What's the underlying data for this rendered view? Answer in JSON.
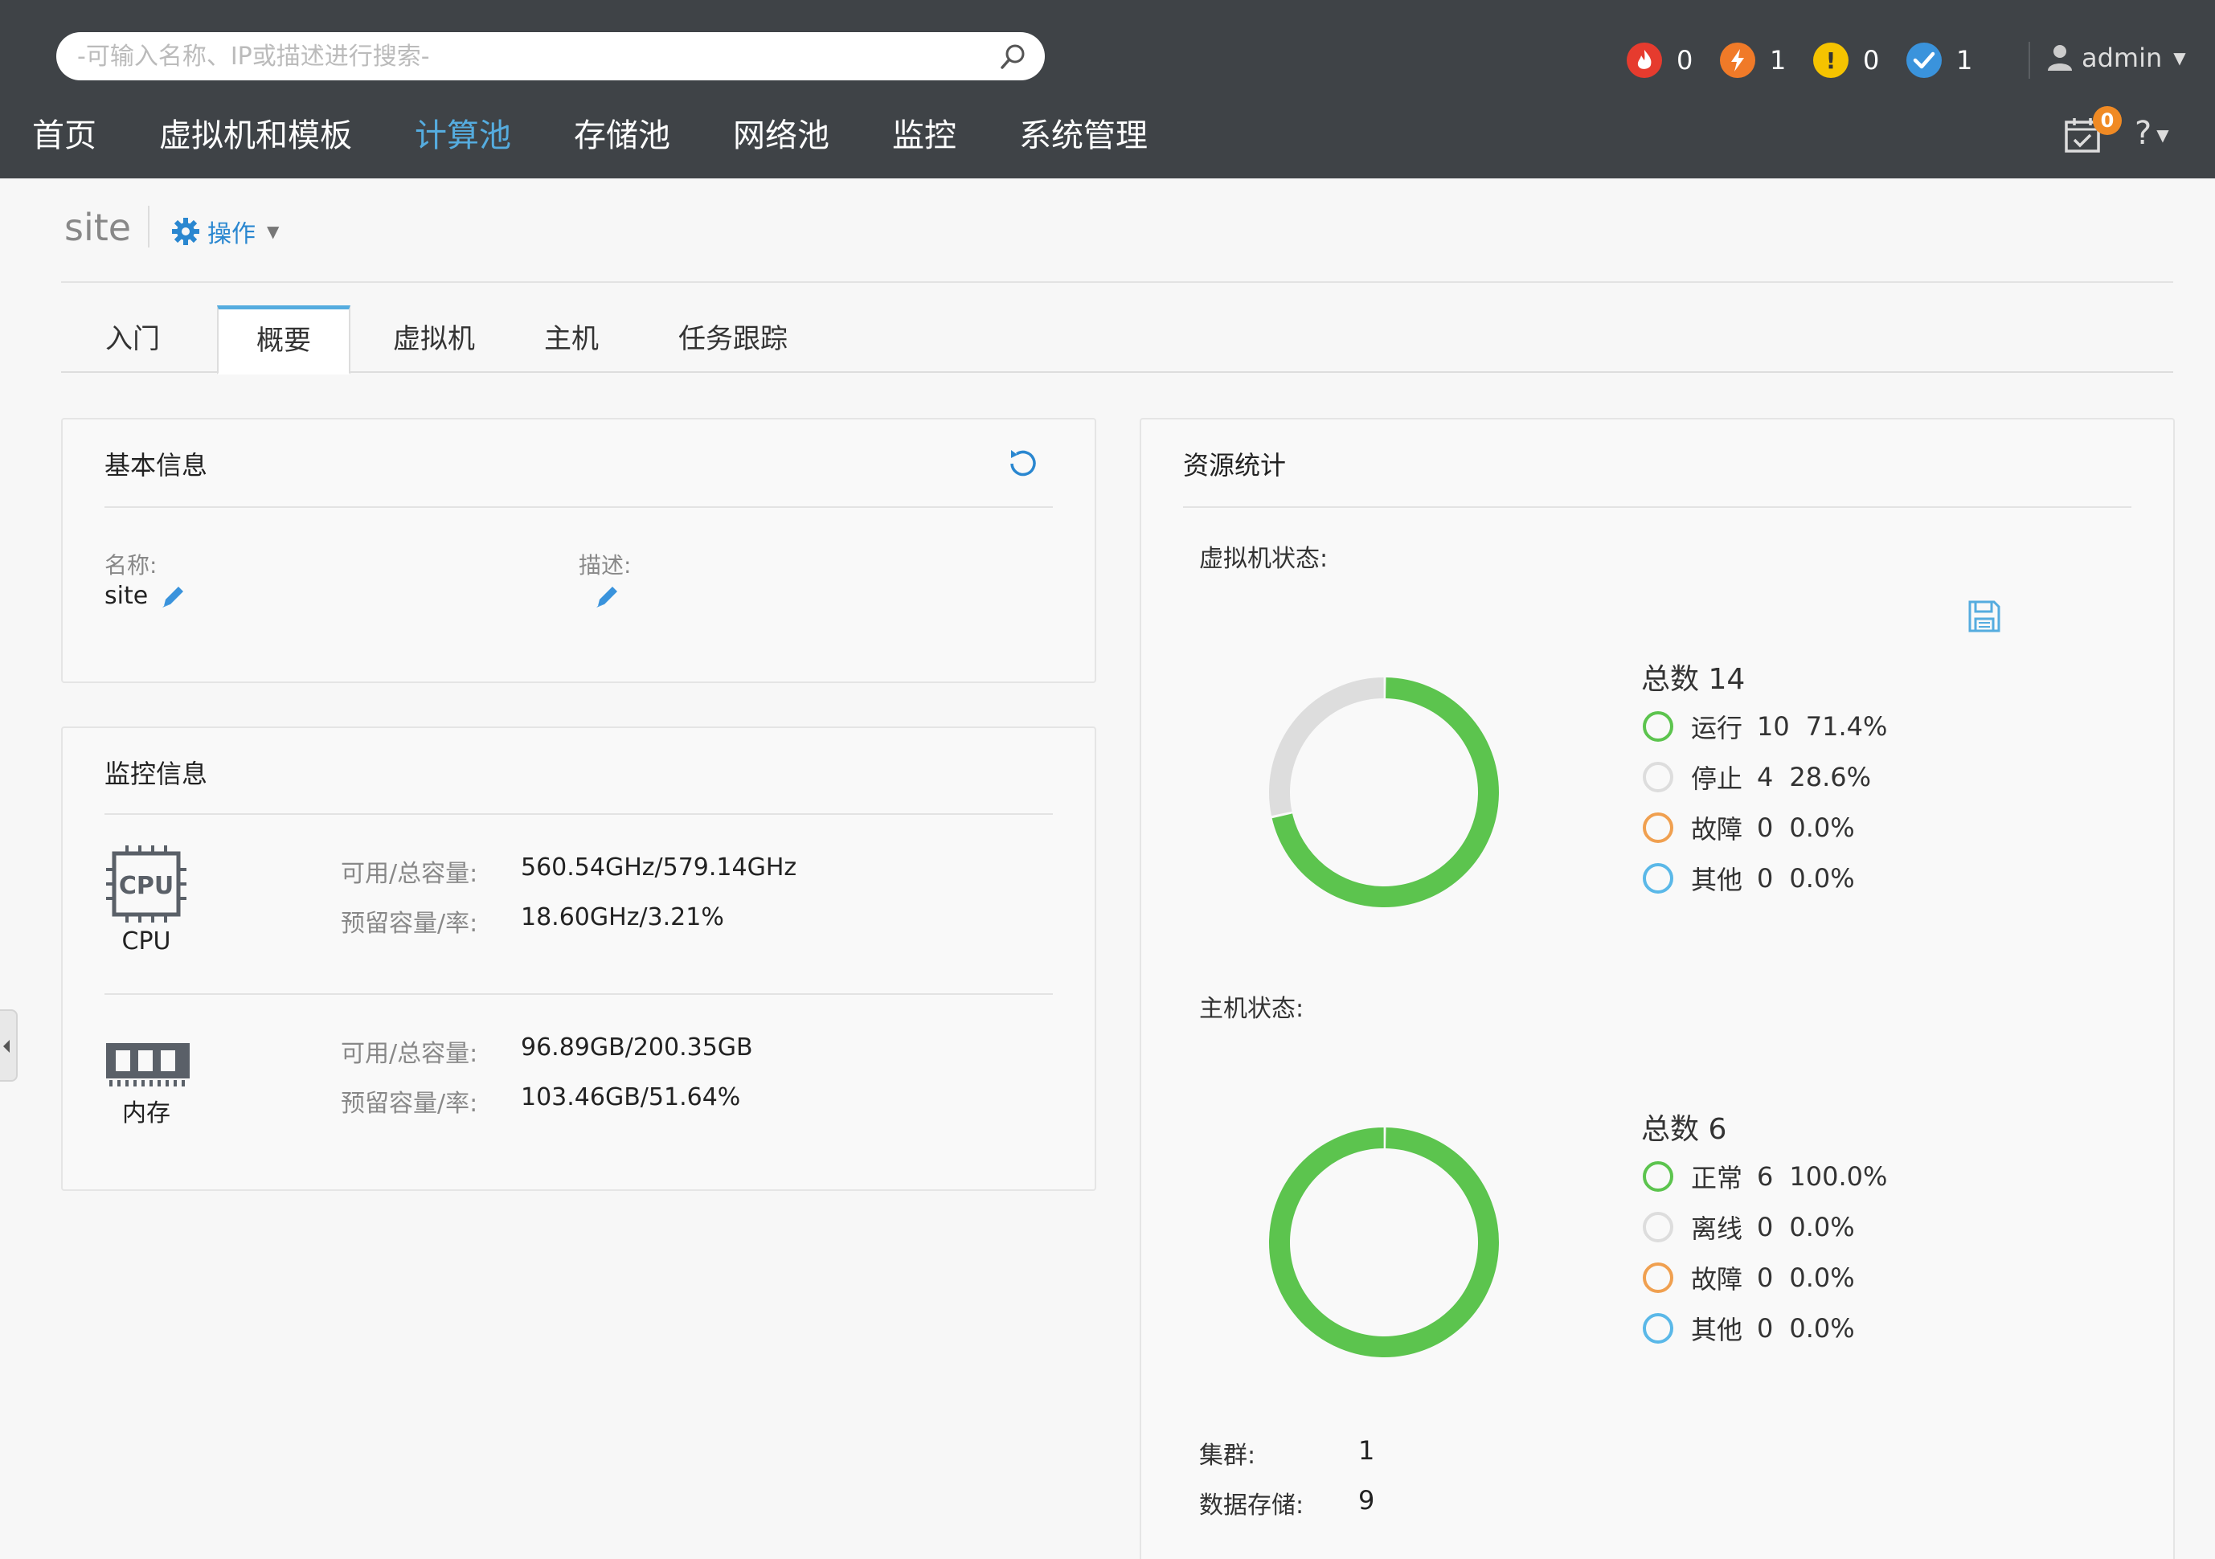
{
  "header": {
    "search": {
      "placeholder": "-可输入名称、IP或描述进行搜索-",
      "value": ""
    },
    "alarms": [
      {
        "level": "critical",
        "count": "0",
        "color": "#e63b2e"
      },
      {
        "level": "major",
        "count": "1",
        "color": "#f07a28"
      },
      {
        "level": "minor",
        "count": "0",
        "color": "#f5c300"
      },
      {
        "level": "info",
        "count": "1",
        "color": "#3a93dc"
      }
    ],
    "user": "admin",
    "tasks_badge": "0",
    "help": "?",
    "accent_color": "#55acdf"
  },
  "nav": {
    "items": [
      "首页",
      "虚拟机和模板",
      "计算池",
      "存储池",
      "网络池",
      "监控",
      "系统管理"
    ],
    "active": "计算池"
  },
  "page": {
    "title": "site",
    "ops_label": "操作"
  },
  "tabs": [
    "入门",
    "概要",
    "虚拟机",
    "主机",
    "任务跟踪"
  ],
  "active_tab": "概要",
  "basic": {
    "title": "基本信息",
    "name_label": "名称:",
    "name_value": "site",
    "desc_label": "描述:",
    "desc_value": ""
  },
  "monitor": {
    "title": "监控信息",
    "cpu": {
      "label": "CPU",
      "icon_text": "CPU",
      "avail_label": "可用/总容量:",
      "avail_value": "560.54GHz/579.14GHz",
      "reserve_label": "预留容量/率:",
      "reserve_value": "18.60GHz/3.21%"
    },
    "memory": {
      "label": "内存",
      "avail_label": "可用/总容量:",
      "avail_value": "96.89GB/200.35GB",
      "reserve_label": "预留容量/率:",
      "reserve_value": "103.46GB/51.64%"
    }
  },
  "resources": {
    "title": "资源统计",
    "vm": {
      "label": "虚拟机状态:",
      "total_text": "总数 14",
      "items": [
        {
          "name": "运行",
          "count": "10",
          "pct": "71.4%",
          "value": 10,
          "color": "#5cc44e"
        },
        {
          "name": "停止",
          "count": "4",
          "pct": "28.6%",
          "value": 4,
          "color": "#dddddd"
        },
        {
          "name": "故障",
          "count": "0",
          "pct": "0.0%",
          "value": 0,
          "color": "#f0a050"
        },
        {
          "name": "其他",
          "count": "0",
          "pct": "0.0%",
          "value": 0,
          "color": "#5ab8e8"
        }
      ]
    },
    "host": {
      "label": "主机状态:",
      "total_text": "总数 6",
      "items": [
        {
          "name": "正常",
          "count": "6",
          "pct": "100.0%",
          "value": 6,
          "color": "#5cc44e"
        },
        {
          "name": "离线",
          "count": "0",
          "pct": "0.0%",
          "value": 0,
          "color": "#dddddd"
        },
        {
          "name": "故障",
          "count": "0",
          "pct": "0.0%",
          "value": 0,
          "color": "#f0a050"
        },
        {
          "name": "其他",
          "count": "0",
          "pct": "0.0%",
          "value": 0,
          "color": "#5ab8e8"
        }
      ]
    },
    "cluster_label": "集群:",
    "cluster_value": "1",
    "datastore_label": "数据存储:",
    "datastore_value": "9"
  }
}
